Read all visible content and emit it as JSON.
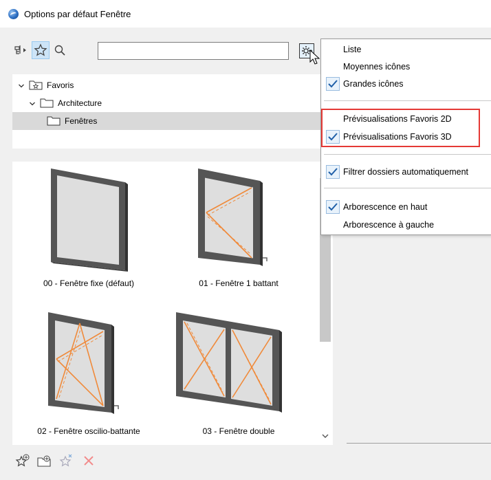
{
  "window": {
    "title": "Options par défaut Fenêtre"
  },
  "toolbar": {
    "icons": [
      "tree-toggle-icon",
      "favorites-star-icon",
      "search-icon"
    ],
    "search_value": "",
    "settings_icon": "gear-icon"
  },
  "tree": {
    "items": [
      {
        "label": "Favoris",
        "expanded": true
      },
      {
        "label": "Architecture",
        "expanded": true
      },
      {
        "label": "Fenêtres",
        "selected": true
      }
    ]
  },
  "favorites": [
    {
      "label": "00 - Fenêtre fixe (défaut)"
    },
    {
      "label": "01 - Fenêtre 1 battant"
    },
    {
      "label": "02 - Fenêtre oscilio-battante"
    },
    {
      "label": "03 - Fenêtre double"
    }
  ],
  "bottom_bar": {
    "icons": [
      "add-favorite-icon",
      "new-folder-icon",
      "redefine-favorite-icon",
      "delete-icon"
    ]
  },
  "menu": {
    "items": [
      {
        "label": "Liste",
        "checked": false
      },
      {
        "label": "Moyennes icônes",
        "checked": false
      },
      {
        "label": "Grandes icônes",
        "checked": true
      },
      {
        "label": "Prévisualisations Favoris 2D",
        "checked": false
      },
      {
        "label": "Prévisualisations Favoris 3D",
        "checked": true
      },
      {
        "label": "Filtrer dossiers automatiquement",
        "checked": true
      },
      {
        "label": "Arborescence en haut",
        "checked": true
      },
      {
        "label": "Arborescence à gauche",
        "checked": false
      }
    ]
  },
  "colors": {
    "highlight_box": "#e53935",
    "check_accent": "#1f5fa8",
    "frame_dark": "#555555",
    "glass": "#d9d9d9",
    "opening_line": "#f08a3a"
  }
}
